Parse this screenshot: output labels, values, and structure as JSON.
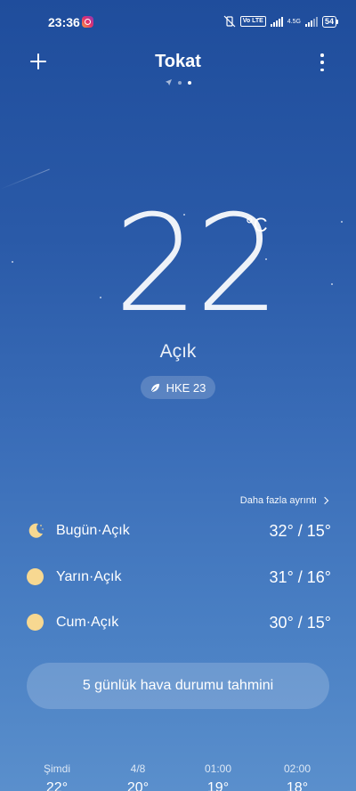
{
  "status_bar": {
    "time": "23:36",
    "network": "4.5G",
    "volte": "Vo LTE",
    "battery": "54"
  },
  "header": {
    "city": "Tokat"
  },
  "current": {
    "temperature": "22",
    "unit": "°C",
    "condition": "Açık",
    "aqi": "HKE 23"
  },
  "details_link": "Daha fazla ayrıntı",
  "forecast": [
    {
      "label": "Bugün·Açık",
      "temps": "32° / 15°",
      "icon": "moon-icon"
    },
    {
      "label": "Yarın·Açık",
      "temps": "31° / 16°",
      "icon": "sun-icon"
    },
    {
      "label": "Cum·Açık",
      "temps": "30° / 15°",
      "icon": "sun-icon"
    }
  ],
  "five_day_button": "5 günlük hava durumu tahmini",
  "hourly": [
    {
      "time": "Şimdi",
      "temp": "22°"
    },
    {
      "time": "4/8",
      "temp": "20°"
    },
    {
      "time": "01:00",
      "temp": "19°"
    },
    {
      "time": "02:00",
      "temp": "18°"
    }
  ],
  "colors": {
    "sun": "#f7d891",
    "background_top": "#1f4d9c",
    "background_bottom": "#5a8fcc"
  }
}
